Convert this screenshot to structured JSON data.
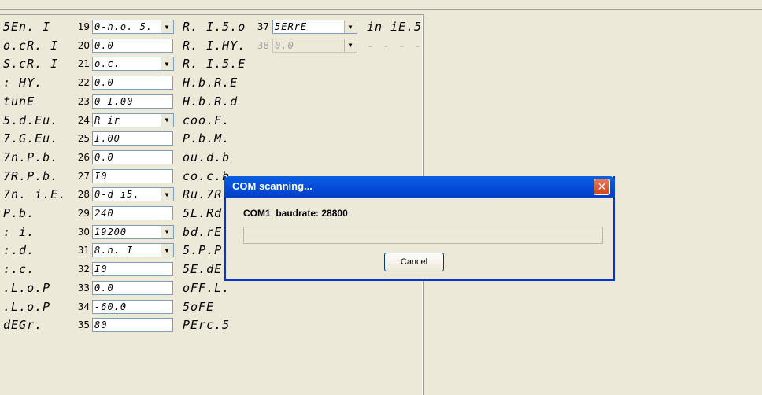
{
  "rows": [
    {
      "label": "5En. I",
      "num": "19",
      "value": "0-n.o. 5.",
      "dropdown": true,
      "right": "R. I.5.o"
    },
    {
      "label": "o.cR. I",
      "num": "20",
      "value": "0.0",
      "dropdown": false,
      "right": "R. I.HY."
    },
    {
      "label": "S.cR. I",
      "num": "21",
      "value": "o.c.",
      "dropdown": true,
      "right": "R. I.5.E"
    },
    {
      "label": ": HY.",
      "num": "22",
      "value": "0.0",
      "dropdown": false,
      "right": "H.b.R.E"
    },
    {
      "label": "tunE",
      "num": "23",
      "value": "0 I.00",
      "dropdown": false,
      "right": "H.b.R.d"
    },
    {
      "label": "5.d.Eu.",
      "num": "24",
      "value": "R ir",
      "dropdown": true,
      "right": "coo.F."
    },
    {
      "label": "7.G.Eu.",
      "num": "25",
      "value": "I.00",
      "dropdown": false,
      "right": "P.b.M."
    },
    {
      "label": "7n.P.b.",
      "num": "26",
      "value": "0.0",
      "dropdown": false,
      "right": "ou.d.b"
    },
    {
      "label": "7R.P.b.",
      "num": "27",
      "value": "I0",
      "dropdown": false,
      "right": "co.c.b"
    },
    {
      "label": "7n. i.E.",
      "num": "28",
      "value": "0-d i5.",
      "dropdown": true,
      "right": "Ru.7R"
    },
    {
      "label": "P.b.",
      "num": "29",
      "value": "240",
      "dropdown": false,
      "right": "5L.Rd"
    },
    {
      "label": ": i.",
      "num": "30",
      "value": "19200",
      "dropdown": true,
      "right": "bd.rE"
    },
    {
      "label": ":.d.",
      "num": "31",
      "value": "8.n. I",
      "dropdown": true,
      "right": "5.P.P."
    },
    {
      "label": ":.c.",
      "num": "32",
      "value": "I0",
      "dropdown": false,
      "right": "5E.dE."
    },
    {
      "label": ".L.o.P",
      "num": "33",
      "value": "0.0",
      "dropdown": false,
      "right": "oFF.L."
    },
    {
      "label": ".L.o.P",
      "num": "34",
      "value": "-60.0",
      "dropdown": false,
      "right": "5oFE"
    },
    {
      "label": "dEGr.",
      "num": "35",
      "value": "80",
      "dropdown": false,
      "right": "PErc.5"
    }
  ],
  "col3": [
    {
      "num": "37",
      "value": "5ERrE",
      "disabled": false,
      "label": "in iE.5"
    },
    {
      "num": "38",
      "value": "0.0",
      "disabled": true,
      "label": "- - - -"
    }
  ],
  "dialog": {
    "title": "COM scanning...",
    "port": "COM1",
    "baud_label": "baudrate:",
    "baud_value": "28800",
    "progress_percent": 0,
    "cancel_label": "Cancel",
    "close_glyph": "✕"
  }
}
